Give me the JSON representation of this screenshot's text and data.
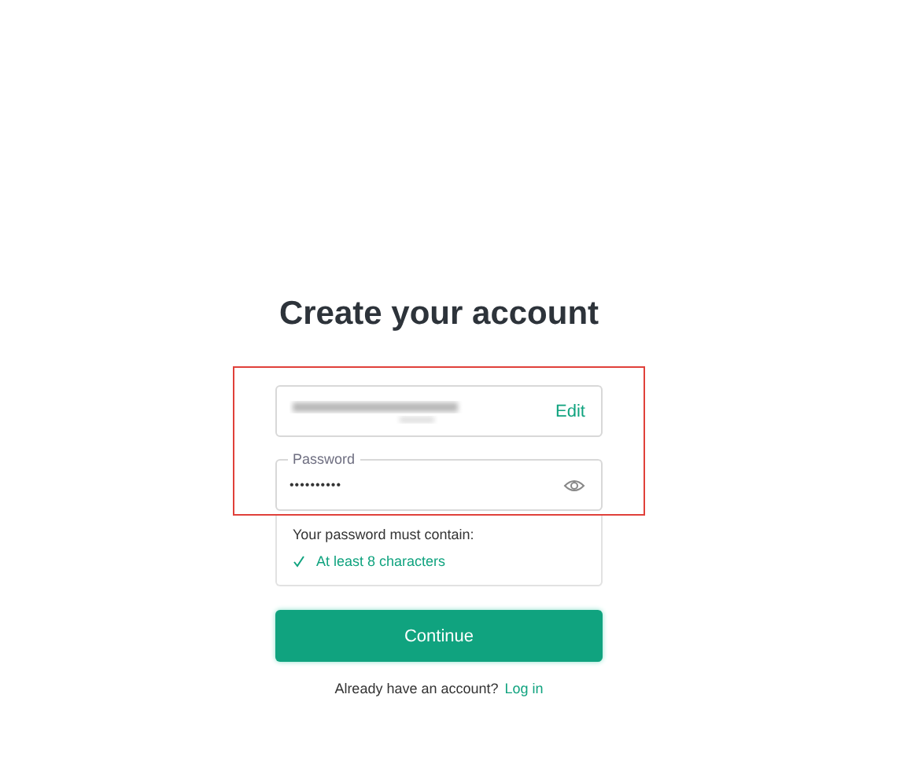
{
  "heading": "Create your account",
  "email_field": {
    "action": "Edit"
  },
  "password_field": {
    "label": "Password",
    "value": "••••••••••"
  },
  "requirements": {
    "title": "Your password must contain:",
    "items": [
      {
        "text": "At least 8 characters",
        "met": true
      }
    ]
  },
  "continue_button": "Continue",
  "login_prompt": {
    "text": "Already have an account?",
    "link": "Log in"
  }
}
